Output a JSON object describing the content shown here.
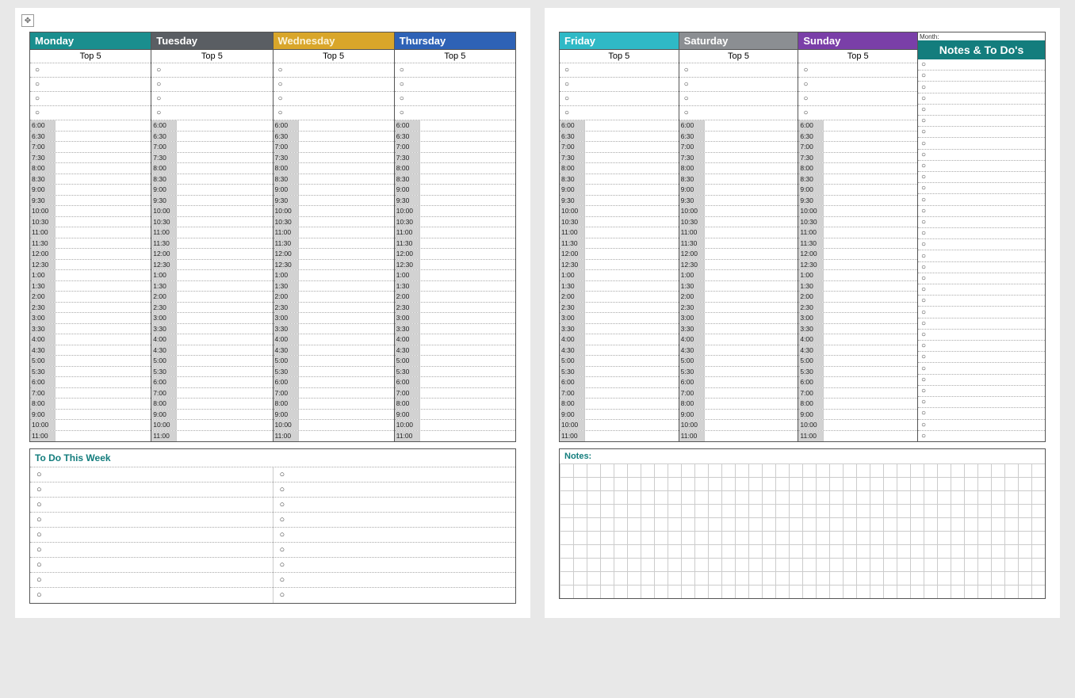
{
  "days_p1": [
    {
      "name": "Monday",
      "color": "#1a8e8e"
    },
    {
      "name": "Tuesday",
      "color": "#5a5e63"
    },
    {
      "name": "Wednesday",
      "color": "#d9a62a",
      "textcolor": "#fbf3d7"
    },
    {
      "name": "Thursday",
      "color": "#2e62b6"
    }
  ],
  "days_p2": [
    {
      "name": "Friday",
      "color": "#2fb9c6"
    },
    {
      "name": "Saturday",
      "color": "#8b8e92"
    },
    {
      "name": "Sunday",
      "color": "#7a3fa8"
    }
  ],
  "top5_label": "Top 5",
  "times": [
    "6:00",
    "6:30",
    "7:00",
    "7:30",
    "8:00",
    "8:30",
    "9:00",
    "9:30",
    "10:00",
    "10:30",
    "11:00",
    "11:30",
    "12:00",
    "12:30",
    "1:00",
    "1:30",
    "2:00",
    "2:30",
    "3:00",
    "3:30",
    "4:00",
    "4:30",
    "5:00",
    "5:30",
    "6:00",
    "7:00",
    "8:00",
    "9:00",
    "10:00",
    "11:00"
  ],
  "todo_week_title": "To Do This Week",
  "todo_week_rows": 9,
  "month_label": "Month:",
  "notes_header": "Notes & To Do's",
  "notes_bullets_count": 34,
  "notes_label": "Notes:"
}
